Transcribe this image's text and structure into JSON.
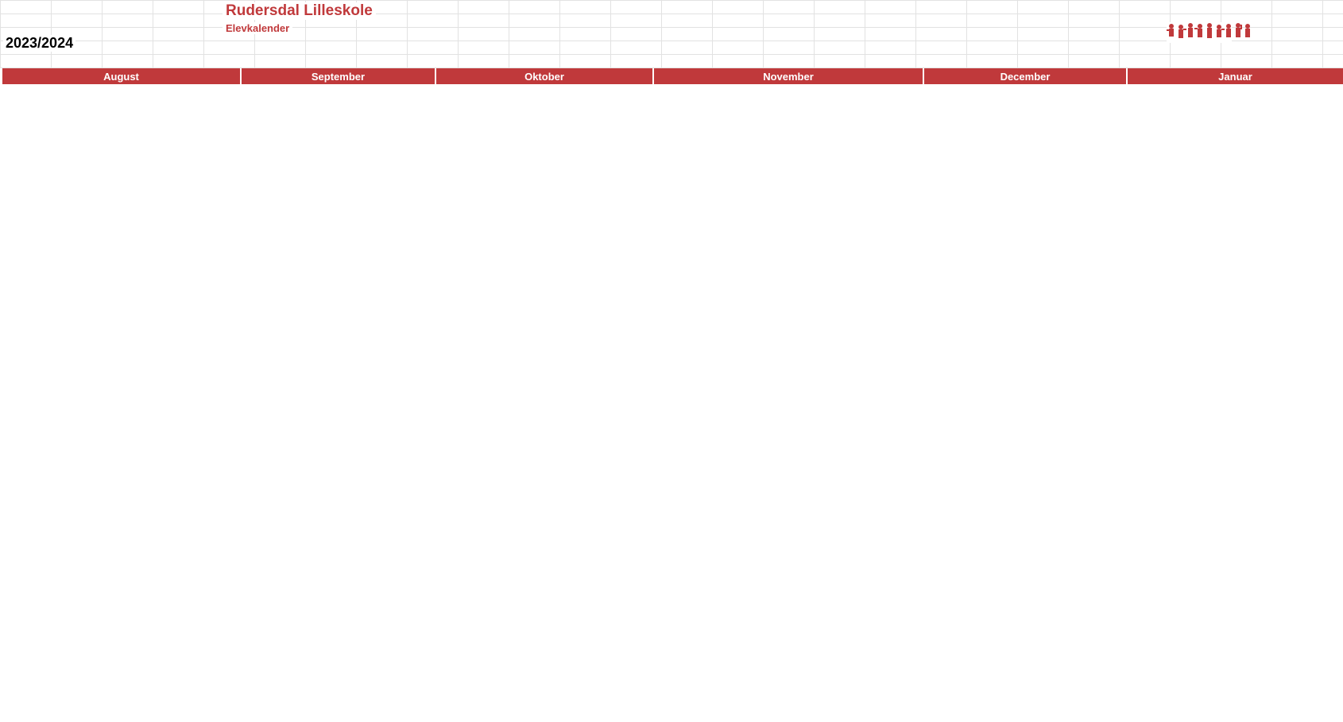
{
  "header": {
    "school": "Rudersdal Lilleskole",
    "subtitle": "Elevkalender",
    "year": "2023/2024",
    "logo_icon": "children-silhouettes-logo"
  },
  "colors": {
    "header_red": "#c0393b",
    "weekend": "#d9d9d9",
    "holiday": "#fdf0c8",
    "public_holiday": "#c6e0b4"
  },
  "months": [
    "August",
    "September",
    "Oktober",
    "November",
    "December",
    "Januar"
  ]
}
